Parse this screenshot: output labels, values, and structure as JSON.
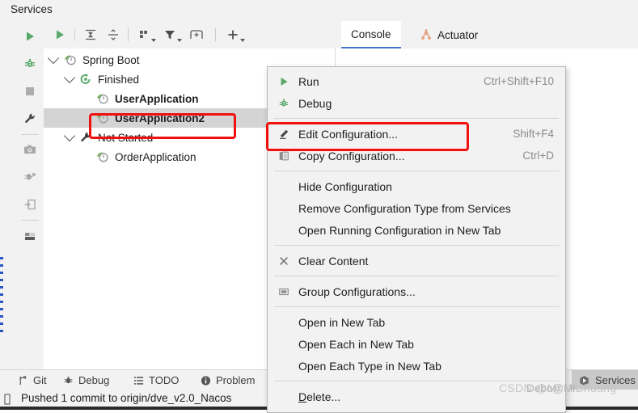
{
  "window": {
    "title": "Services"
  },
  "rail": {
    "items": [
      {
        "name": "run-button",
        "icon": "play-icon",
        "label": "Run"
      },
      {
        "name": "debug-button",
        "icon": "bug-icon",
        "label": "Debug"
      },
      {
        "name": "stop-button",
        "icon": "stop-icon",
        "label": "Stop"
      },
      {
        "name": "settings-button",
        "icon": "wrench-icon",
        "label": "Settings"
      },
      {
        "name": "screenshot-button",
        "icon": "camera-icon",
        "label": "Screenshot"
      },
      {
        "name": "attach-debugger-button",
        "icon": "bug-arrow-icon",
        "label": "Attach Debugger"
      },
      {
        "name": "import-button",
        "icon": "import-arrow-icon",
        "label": "Import"
      },
      {
        "name": "layout-button",
        "icon": "layout-icon",
        "label": "Layout"
      }
    ]
  },
  "toolbar": {
    "buttons": [
      {
        "name": "rerun-button",
        "icon": "play-icon",
        "label": "Rerun"
      },
      {
        "name": "expand-all-button",
        "icon": "expand-all-icon",
        "label": "Expand All"
      },
      {
        "name": "collapse-all-button",
        "icon": "collapse-all-icon",
        "label": "Collapse All"
      },
      {
        "name": "group-by-button",
        "icon": "group-by-icon",
        "label": "Group By"
      },
      {
        "name": "filter-button",
        "icon": "filter-icon",
        "label": "Filter"
      },
      {
        "name": "add-tab-button",
        "icon": "new-tab-icon",
        "label": "Open in New Tab"
      },
      {
        "name": "add-service-button",
        "icon": "plus-icon",
        "label": "Add Service"
      }
    ]
  },
  "tree": {
    "nodes": [
      {
        "label": "Spring Boot",
        "icon": "spring-boot-icon",
        "indent": 10,
        "arrow": true,
        "bold": false,
        "selected": false
      },
      {
        "label": "Finished",
        "icon": "finished-icon",
        "indent": 30,
        "arrow": true,
        "bold": false,
        "selected": false
      },
      {
        "label": "UserApplication",
        "icon": "spring-boot-icon",
        "indent": 60,
        "arrow": false,
        "bold": true,
        "selected": false
      },
      {
        "label": "UserApplication2",
        "icon": "spring-boot-icon",
        "indent": 60,
        "arrow": false,
        "bold": true,
        "selected": true
      },
      {
        "label": "Not Started",
        "icon": "wrench-icon",
        "indent": 30,
        "arrow": true,
        "bold": false,
        "selected": false
      },
      {
        "label": "OrderApplication",
        "icon": "spring-boot-icon",
        "indent": 60,
        "arrow": false,
        "bold": false,
        "selected": false
      }
    ]
  },
  "tabs": [
    {
      "label": "Console",
      "icon": "none",
      "active": true
    },
    {
      "label": "Actuator",
      "icon": "actuator-icon",
      "active": false
    }
  ],
  "context_menu": {
    "groups": [
      {
        "items": [
          {
            "label": "Run",
            "shortcut": "Ctrl+Shift+F10",
            "icon": "play-icon",
            "highlighted": false
          },
          {
            "label": "Debug",
            "shortcut": "",
            "icon": "bug-icon",
            "highlighted": false
          }
        ]
      },
      {
        "items": [
          {
            "label": "Edit Configuration...",
            "shortcut": "Shift+F4",
            "icon": "pencil-icon",
            "highlighted": true
          },
          {
            "label": "Copy Configuration...",
            "shortcut": "Ctrl+D",
            "icon": "copy-icon",
            "highlighted": false
          }
        ]
      },
      {
        "items": [
          {
            "label": "Hide Configuration",
            "shortcut": "",
            "icon": "none",
            "highlighted": false
          },
          {
            "label": "Remove Configuration Type from Services",
            "shortcut": "",
            "icon": "none",
            "highlighted": false
          },
          {
            "label": "Open Running Configuration in New Tab",
            "shortcut": "",
            "icon": "none",
            "highlighted": false
          }
        ]
      },
      {
        "items": [
          {
            "label": "Clear Content",
            "shortcut": "",
            "icon": "close-x-icon",
            "highlighted": false
          }
        ]
      },
      {
        "items": [
          {
            "label": "Group Configurations...",
            "shortcut": "",
            "icon": "folder-icon",
            "highlighted": false
          }
        ]
      },
      {
        "items": [
          {
            "label": "Open in New Tab",
            "shortcut": "",
            "icon": "none",
            "highlighted": false
          },
          {
            "label": "Open Each in New Tab",
            "shortcut": "",
            "icon": "none",
            "highlighted": false
          },
          {
            "label": "Open Each Type in New Tab",
            "shortcut": "",
            "icon": "none",
            "highlighted": false
          }
        ]
      },
      {
        "items": [
          {
            "label": "Delete...",
            "shortcut": "",
            "icon": "none",
            "highlighted": false,
            "mnemonic": "D"
          }
        ]
      }
    ]
  },
  "tool_window_bar": {
    "left_items": [
      {
        "label": "Git",
        "icon": "git-branch-icon"
      },
      {
        "label": "Debug",
        "icon": "bug-icon"
      },
      {
        "label": "TODO",
        "icon": "list-icon"
      },
      {
        "label": "Problem",
        "icon": "info-icon"
      }
    ],
    "right_items": [
      {
        "label": "Services",
        "icon": "services-icon",
        "active": true
      }
    ]
  },
  "status_bar": {
    "message": "Pushed 1 commit to origin/dve_v2.0_Nacos",
    "icon": "branch-icon"
  },
  "watermark": {
    "text_back": "CSDN @Mr.D.Chuang",
    "text_front": "Debo@Mr."
  },
  "colors": {
    "accent_green": "#59a869",
    "highlight_red": "#f01010",
    "selection_gray": "#d4d4d4",
    "tab_underline": "#4177c9",
    "actuator_orange": "#e8a080",
    "panel_bg": "#f2f2f2"
  }
}
